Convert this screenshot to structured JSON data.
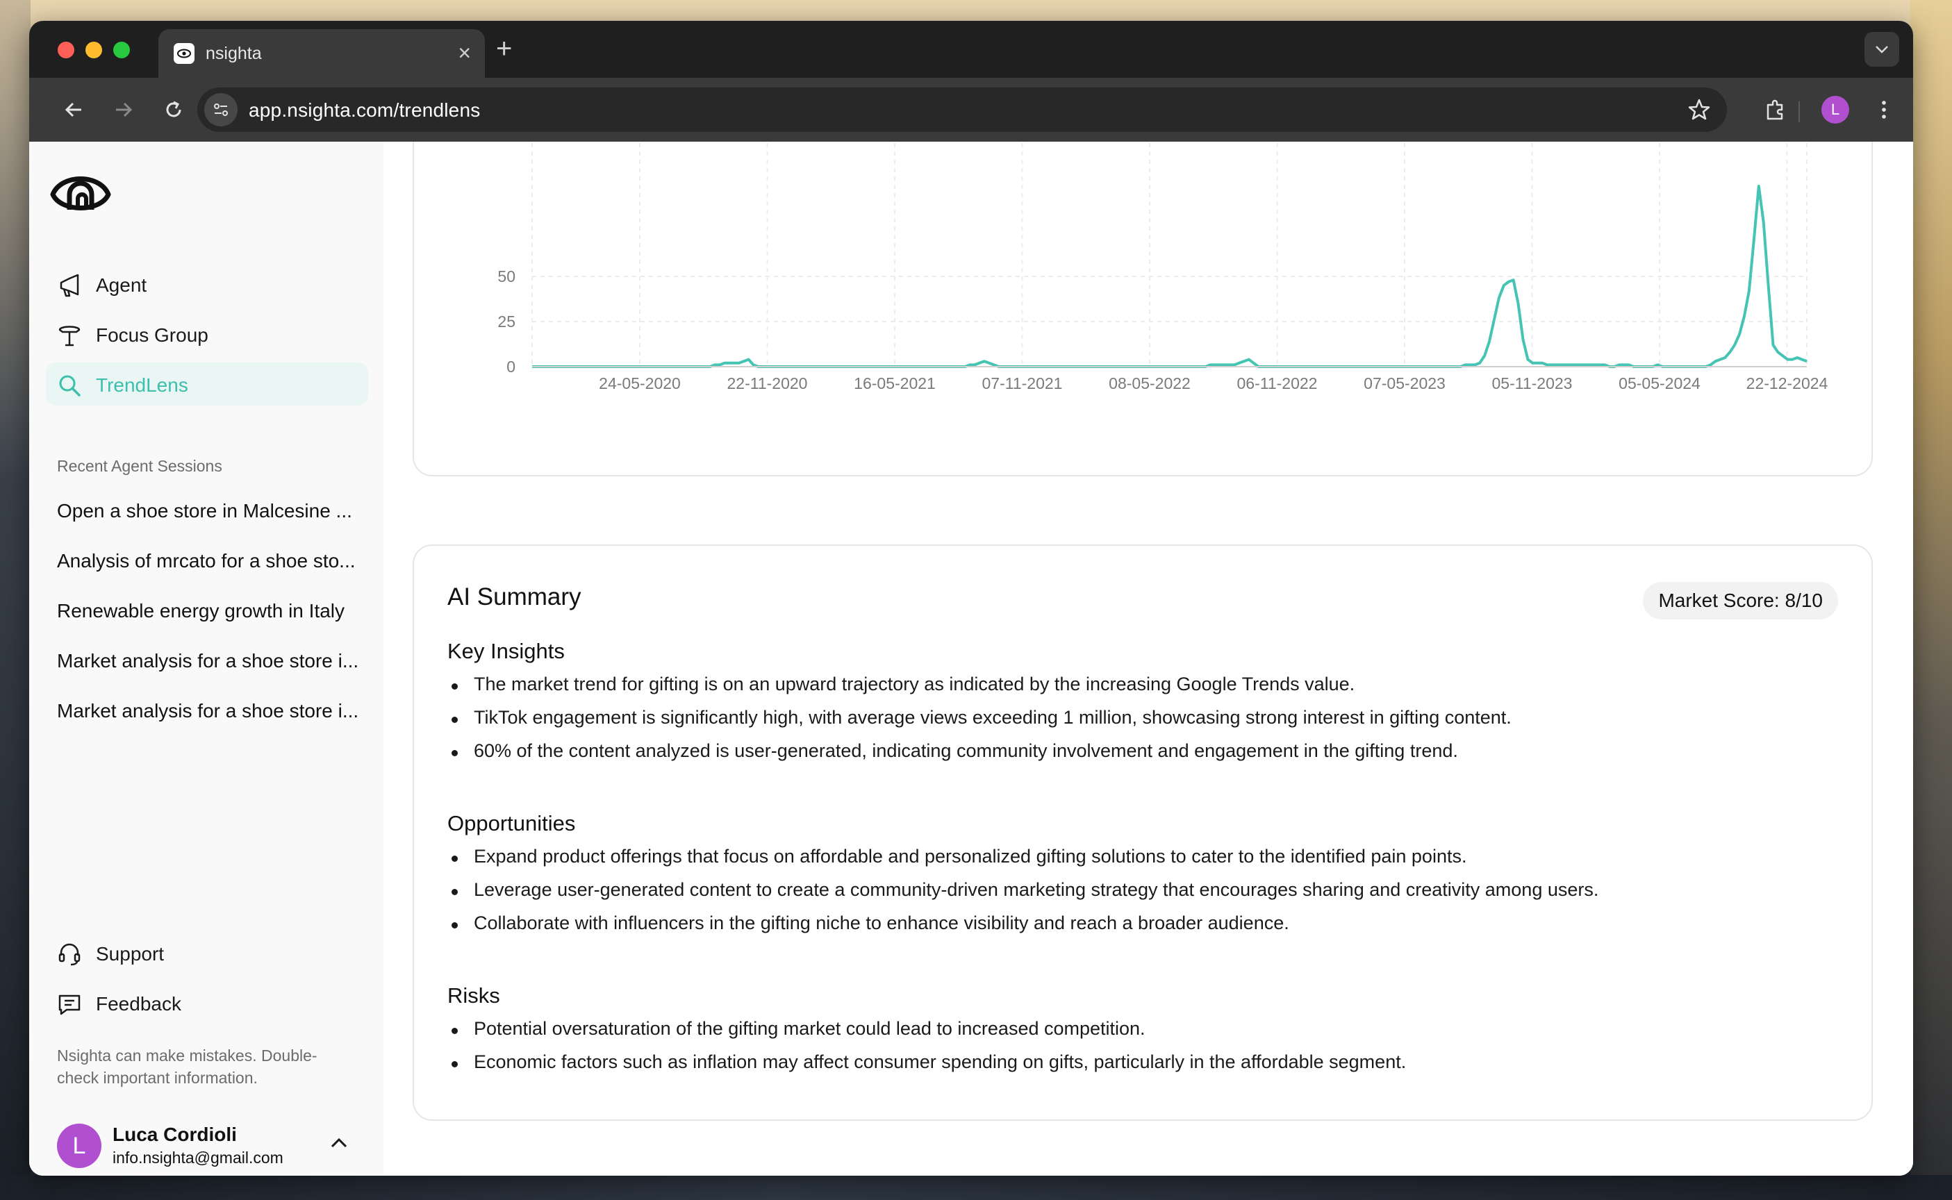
{
  "browser": {
    "tab_title": "nsighta",
    "url": "app.nsighta.com/trendlens",
    "profile_initial": "L",
    "new_tab_symbol": "+",
    "close_symbol": "×"
  },
  "sidebar": {
    "nav": [
      {
        "label": "Agent",
        "icon": "megaphone-icon"
      },
      {
        "label": "Focus Group",
        "icon": "lamp-icon"
      },
      {
        "label": "TrendLens",
        "icon": "search-icon",
        "active": true
      }
    ],
    "recent_title": "Recent Agent Sessions",
    "sessions": [
      "Open a shoe store in Malcesine ...",
      "Analysis of mrcato for a shoe sto...",
      "Renewable energy growth in Italy",
      "Market analysis for a shoe store i...",
      "Market analysis for a shoe store i..."
    ],
    "footer_nav": [
      {
        "label": "Support",
        "icon": "headset-icon"
      },
      {
        "label": "Feedback",
        "icon": "chat-icon"
      }
    ],
    "disclaimer": "Nsighta can make mistakes. Double-check important information.",
    "user": {
      "initial": "L",
      "name": "Luca Cordioli",
      "email": "info.nsighta@gmail.com"
    }
  },
  "chart_data": {
    "type": "line",
    "color": "#45c4b4",
    "yticks": [
      0,
      25,
      50
    ],
    "ylim": [
      0,
      65
    ],
    "x_tick_labels": [
      "24-05-2020",
      "22-11-2020",
      "16-05-2021",
      "07-11-2021",
      "08-05-2022",
      "06-11-2022",
      "07-05-2023",
      "05-11-2023",
      "05-05-2024",
      "22-12-2024"
    ],
    "values": [
      0,
      0,
      0,
      0,
      0,
      0,
      0,
      0,
      0,
      0,
      0,
      0,
      0,
      0,
      0,
      0,
      0,
      0,
      0,
      0,
      0,
      0,
      0,
      0,
      0,
      0,
      0,
      0,
      0,
      0,
      0,
      0,
      0,
      0,
      0,
      0,
      0,
      0,
      1,
      1,
      2,
      2,
      2,
      2,
      3,
      4,
      1,
      0,
      0,
      0,
      0,
      0,
      0,
      0,
      0,
      0,
      0,
      0,
      0,
      0,
      0,
      0,
      0,
      0,
      0,
      0,
      0,
      0,
      0,
      0,
      0,
      0,
      0,
      0,
      0,
      0,
      0,
      0,
      0,
      0,
      0,
      0,
      0,
      0,
      0,
      0,
      0,
      0,
      0,
      0,
      0,
      1,
      1,
      2,
      3,
      2,
      1,
      0,
      0,
      0,
      0,
      0,
      0,
      0,
      0,
      0,
      0,
      0,
      0,
      0,
      0,
      0,
      0,
      0,
      0,
      0,
      0,
      0,
      0,
      0,
      0,
      0,
      0,
      0,
      0,
      0,
      0,
      0,
      0,
      0,
      0,
      0,
      0,
      0,
      0,
      0,
      0,
      0,
      0,
      0,
      0,
      1,
      1,
      1,
      1,
      1,
      1,
      2,
      3,
      4,
      2,
      0,
      0,
      0,
      0,
      0,
      0,
      0,
      0,
      0,
      0,
      0,
      0,
      0,
      0,
      0,
      0,
      0,
      0,
      0,
      0,
      0,
      0,
      0,
      0,
      0,
      0,
      0,
      0,
      0,
      0,
      0,
      0,
      0,
      0,
      0,
      0,
      0,
      0,
      0,
      0,
      0,
      0,
      0,
      1,
      1,
      1,
      2,
      6,
      14,
      26,
      38,
      45,
      47,
      48,
      35,
      15,
      4,
      2,
      2,
      2,
      1,
      1,
      1,
      1,
      1,
      1,
      1,
      1,
      1,
      1,
      1,
      1,
      1,
      0,
      0,
      1,
      1,
      1,
      0,
      0,
      0,
      0,
      0,
      1,
      0,
      0,
      0,
      0,
      0,
      0,
      0,
      0,
      0,
      0,
      1,
      3,
      4,
      5,
      8,
      12,
      18,
      28,
      42,
      70,
      100,
      80,
      45,
      12,
      8,
      6,
      4,
      4,
      5,
      4,
      3
    ]
  },
  "summary": {
    "title": "AI Summary",
    "score": "Market Score: 8/10",
    "sections": [
      {
        "heading": "Key Insights",
        "items": [
          "The market trend for gifting is on an upward trajectory as indicated by the increasing Google Trends value.",
          "TikTok engagement is significantly high, with average views exceeding 1 million, showcasing strong interest in gifting content.",
          "60% of the content analyzed is user-generated, indicating community involvement and engagement in the gifting trend."
        ]
      },
      {
        "heading": "Opportunities",
        "items": [
          "Expand product offerings that focus on affordable and personalized gifting solutions to cater to the identified pain points.",
          "Leverage user-generated content to create a community-driven marketing strategy that encourages sharing and creativity among users.",
          "Collaborate with influencers in the gifting niche to enhance visibility and reach a broader audience."
        ]
      },
      {
        "heading": "Risks",
        "items": [
          "Potential oversaturation of the gifting market could lead to increased competition.",
          "Economic factors such as inflation may affect consumer spending on gifts, particularly in the affordable segment."
        ]
      }
    ]
  }
}
